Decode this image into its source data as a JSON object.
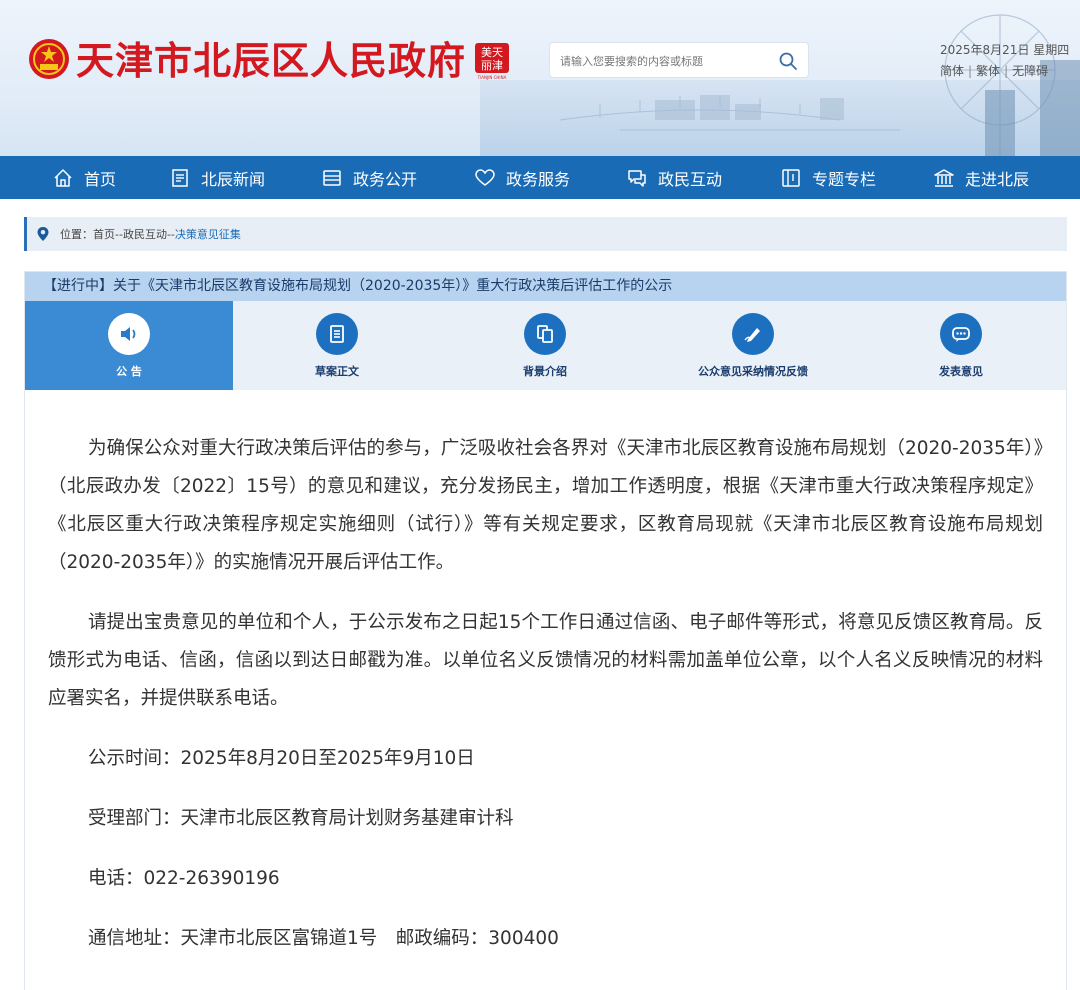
{
  "header": {
    "site_title": "天津市北辰区人民政府",
    "search_placeholder": "请输入您要搜索的内容或标题",
    "date": "2025年8月21日 星期四",
    "lang": {
      "simplified": "简体",
      "traditional": "繁体",
      "accessible": "无障碍"
    }
  },
  "nav": {
    "items": [
      {
        "label": "首页",
        "icon": "home-icon"
      },
      {
        "label": "北辰新闻",
        "icon": "news-icon"
      },
      {
        "label": "政务公开",
        "icon": "open-icon"
      },
      {
        "label": "政务服务",
        "icon": "heart-icon"
      },
      {
        "label": "政民互动",
        "icon": "chat-icon"
      },
      {
        "label": "专题专栏",
        "icon": "book-icon"
      },
      {
        "label": "走进北辰",
        "icon": "building-icon"
      }
    ]
  },
  "breadcrumb": {
    "prefix": "位置：",
    "home": "首页",
    "sep": "--",
    "level1": "政民互动",
    "current": "决策意见征集"
  },
  "panel": {
    "title": "【进行中】关于《天津市北辰区教育设施布局规划（2020-2035年）》重大行政决策后评估工作的公示",
    "tabs": [
      {
        "label": "公 告",
        "icon": "speaker-icon",
        "active": true
      },
      {
        "label": "草案正文",
        "icon": "document-icon",
        "active": false
      },
      {
        "label": "背景介绍",
        "icon": "copy-icon",
        "active": false
      },
      {
        "label": "公众意见采纳情况反馈",
        "icon": "pen-icon",
        "active": false
      },
      {
        "label": "发表意见",
        "icon": "comment-icon",
        "active": false
      }
    ]
  },
  "content": {
    "p1": "为确保公众对重大行政决策后评估的参与，广泛吸收社会各界对《天津市北辰区教育设施布局规划（2020-2035年）》（北辰政办发〔2022〕15号）的意见和建议，充分发扬民主，增加工作透明度，根据《天津市重大行政决策程序规定》《北辰区重大行政决策程序规定实施细则（试行）》等有关规定要求，区教育局现就《天津市北辰区教育设施布局规划（2020-2035年）》的实施情况开展后评估工作。",
    "p2": "请提出宝贵意见的单位和个人，于公示发布之日起15个工作日通过信函、电子邮件等形式，将意见反馈区教育局。反馈形式为电话、信函，信函以到达日邮戳为准。以单位名义反馈情况的材料需加盖单位公章，以个人名义反映情况的材料应署实名，并提供联系电话。",
    "period": "公示时间：2025年8月20日至2025年9月10日",
    "department": "受理部门：天津市北辰区教育局计划财务基建审计科",
    "phone": "电话：022-26390196",
    "address": "通信地址：天津市北辰区富锦道1号　邮政编码：300400"
  }
}
